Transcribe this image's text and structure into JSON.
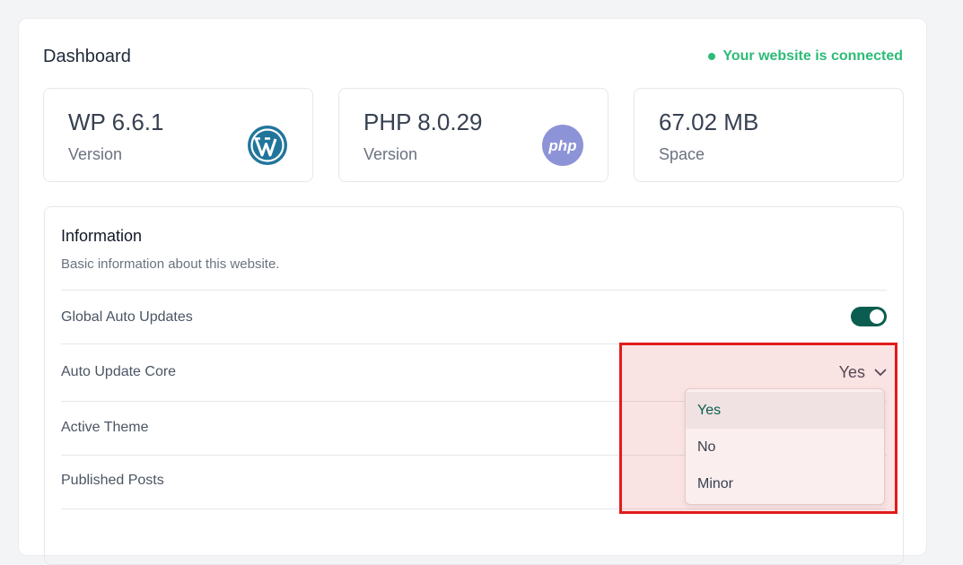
{
  "header": {
    "title": "Dashboard",
    "status_text": "Your website is connected",
    "status_color": "#2dbb78"
  },
  "cards": [
    {
      "value": "WP 6.6.1",
      "label": "Version",
      "icon": "wordpress-icon"
    },
    {
      "value": "PHP 8.0.29",
      "label": "Version",
      "icon": "php-icon"
    },
    {
      "value": "67.02 MB",
      "label": "Space",
      "icon": ""
    }
  ],
  "info": {
    "title": "Information",
    "subtitle": "Basic information about this website.",
    "rows": [
      {
        "label": "Global Auto Updates",
        "control": "toggle",
        "on": true
      },
      {
        "label": "Auto Update Core",
        "control": "select",
        "value": "Yes"
      },
      {
        "label": "Active Theme"
      },
      {
        "label": "Published Posts"
      }
    ]
  },
  "dropdown": {
    "options": [
      "Yes",
      "No",
      "Minor"
    ],
    "selected": "Yes"
  },
  "colors": {
    "accent": "#0b5e4f",
    "highlight_border": "#e31b1b"
  }
}
